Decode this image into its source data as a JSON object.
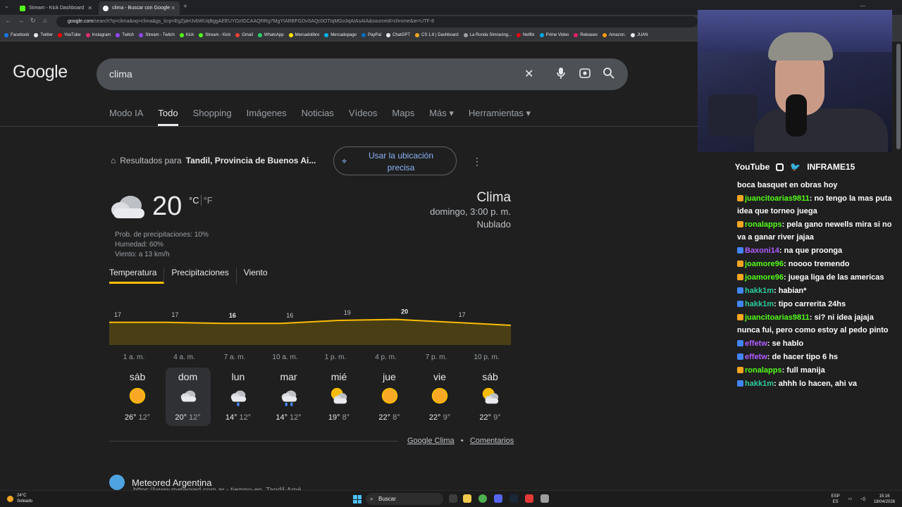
{
  "browser": {
    "tabs": [
      {
        "label": "Stream - Kick Dashboard",
        "color": "#53fc18"
      },
      {
        "label": "clima - Buscar con Google",
        "color": "#ffffff"
      }
    ],
    "new_tab": "+",
    "url_host": "google.com",
    "url_rest": "/search?q=clima&oq=clima&gs_lcrp=EgZjaHJvbWUqBggAEEUYOzIGCAAQRRg7MgYIARBFGDvSAQc0OTIqMGo3qAIAsAIA&sourceid=chrome&ie=UTF-8",
    "bookmarks": [
      {
        "label": "Facebook",
        "color": "#1877f2"
      },
      {
        "label": "Twitter",
        "color": "#e8eaed"
      },
      {
        "label": "YouTube",
        "color": "#ff0000"
      },
      {
        "label": "Instagram",
        "color": "#e1306c"
      },
      {
        "label": "Twitch",
        "color": "#9146ff"
      },
      {
        "label": "Stream - Twitch",
        "color": "#9146ff"
      },
      {
        "label": "Kick",
        "color": "#53fc18"
      },
      {
        "label": "Stream - Kick",
        "color": "#53fc18"
      },
      {
        "label": "Gmail",
        "color": "#ea4335"
      },
      {
        "label": "WhatsApp",
        "color": "#25d366"
      },
      {
        "label": "Mercadolibre",
        "color": "#ffe600"
      },
      {
        "label": "Mercadopago",
        "color": "#00b1ea"
      },
      {
        "label": "PayPal",
        "color": "#0070ba"
      },
      {
        "label": "ChatGPT",
        "color": "#e8eaed"
      },
      {
        "label": "CS 1.6 | Dashboard",
        "color": "#f5a623"
      },
      {
        "label": "La Ronda Simracing...",
        "color": "#9aa0a6"
      },
      {
        "label": "Netflix",
        "color": "#e50914"
      },
      {
        "label": "Prime Video",
        "color": "#00a8e1"
      },
      {
        "label": "Releases",
        "color": "#e91e63"
      },
      {
        "label": "Amazon.",
        "color": "#ff9900"
      },
      {
        "label": "JUAN",
        "color": "#e8eaed"
      }
    ]
  },
  "google": {
    "logo": "Google",
    "query": "clima",
    "tabs": [
      "Modo IA",
      "Todo",
      "Shopping",
      "Imágenes",
      "Noticias",
      "Vídeos",
      "Maps",
      "Más ▾",
      "Herramientas ▾"
    ],
    "active_tab": "Todo",
    "results_for_prefix": "Resultados para",
    "results_for_place": "Tandil, Provincia de Buenos Ai...",
    "location_button": "Usar la ubicación precisa",
    "weather": {
      "temp": "20",
      "unit_c": "°C",
      "unit_f": "°F",
      "heading": "Clima",
      "datetime": "domingo, 3:00 p. m.",
      "condition": "Nublado",
      "precip": "Prob. de precipitaciones: 10%",
      "humidity": "Humedad: 60%",
      "wind": "Viento: a 13 km/h",
      "tabs": [
        "Temperatura",
        "Precipitaciones",
        "Viento"
      ],
      "days": [
        {
          "name": "sáb",
          "hi": "26°",
          "lo": "12°",
          "icon": "sun-icon"
        },
        {
          "name": "dom",
          "hi": "20°",
          "lo": "12°",
          "icon": "cloud-icon"
        },
        {
          "name": "lun",
          "hi": "14°",
          "lo": "12°",
          "icon": "rain-icon"
        },
        {
          "name": "mar",
          "hi": "14°",
          "lo": "12°",
          "icon": "rain-heavy-icon"
        },
        {
          "name": "mié",
          "hi": "19°",
          "lo": "8°",
          "icon": "partly-cloudy-icon"
        },
        {
          "name": "jue",
          "hi": "22°",
          "lo": "8°",
          "icon": "sun-icon"
        },
        {
          "name": "vie",
          "hi": "22°",
          "lo": "9°",
          "icon": "sun-icon"
        },
        {
          "name": "sáb",
          "hi": "22°",
          "lo": "9°",
          "icon": "partly-cloudy-icon"
        }
      ],
      "google_clima": "Google Clima",
      "comentarios": "Comentarios",
      "dot": "•"
    },
    "meteored": {
      "name": "Meteored Argentina",
      "url": "https://www.meteored.com.ar › tiempo-en_Tandil-Amé..."
    }
  },
  "chart_data": {
    "type": "area",
    "x": [
      "1 a. m.",
      "4 a. m.",
      "7 a. m.",
      "10 a. m.",
      "1 p. m.",
      "4 p. m.",
      "7 p. m.",
      "10 p. m."
    ],
    "values": [
      17,
      17,
      16,
      16,
      19,
      20,
      17,
      14
    ],
    "color": "#fbbc04"
  },
  "stream": {
    "social": [
      "YouTube",
      "INFRAME15"
    ],
    "chat": [
      {
        "user": "",
        "text": "boca basquet en obras hoy",
        "color": "#ffffff"
      },
      {
        "user": "juancitoarias9811",
        "text": ": no tengo la mas puta idea que torneo juega",
        "color": "#53fc18"
      },
      {
        "user": "ronalapps",
        "text": ": pela gano newells mira si no va a ganar river jajaa",
        "color": "#53fc18"
      },
      {
        "user": "Baxoni14",
        "text": ": na que proonga",
        "color": "#b05cff"
      },
      {
        "user": "joamore96",
        "text": ": noooo tremendo",
        "color": "#53fc18"
      },
      {
        "user": "joamore96",
        "text": ": juega liga de las americas",
        "color": "#53fc18"
      },
      {
        "user": "hakk1m",
        "text": ": habian*",
        "color": "#2ecc9f"
      },
      {
        "user": "hakk1m",
        "text": ": tipo carrerita 24hs",
        "color": "#2ecc9f"
      },
      {
        "user": "juancitoarias9811",
        "text": ": si? ni idea jajaja nunca fui, pero como estoy al pedo pinto",
        "color": "#53fc18"
      },
      {
        "user": "effetw",
        "text": ": se hablo",
        "color": "#b05cff"
      },
      {
        "user": "effetw",
        "text": ": de hacer tipo 6 hs",
        "color": "#b05cff"
      },
      {
        "user": "ronalapps",
        "text": ": full manija",
        "color": "#53fc18"
      },
      {
        "user": "hakk1m",
        "text": ": ahhh lo hacen, ahi va",
        "color": "#2ecc9f"
      }
    ]
  },
  "taskbar": {
    "weather_temp": "24°C",
    "weather_cond": "Soleado",
    "search": "Buscar",
    "lang": "ESP",
    "lang2": "ES",
    "time": "15:16",
    "date": "18/04/2026"
  }
}
